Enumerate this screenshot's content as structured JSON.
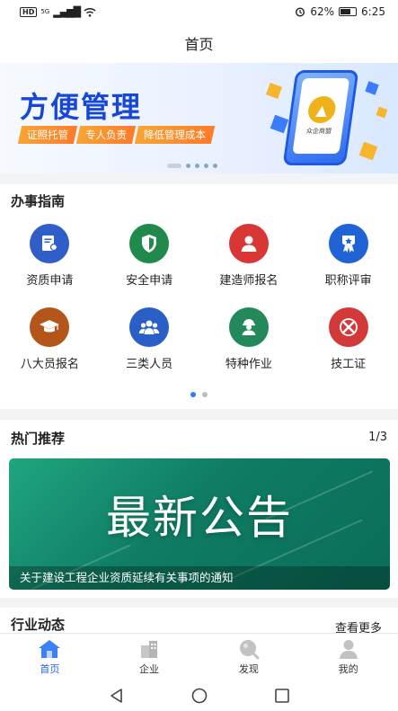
{
  "status": {
    "net": "5G",
    "signal": "..ıl",
    "battery": "62%",
    "time": "6:25"
  },
  "nav": {
    "title": "首页"
  },
  "banner": {
    "title": "方便管理",
    "tags": [
      "证照托管",
      "专人负责",
      "降低管理成本"
    ],
    "phone_text": "众企商盟"
  },
  "guide": {
    "title": "办事指南",
    "items": [
      {
        "label": "资质申请",
        "icon": "certificate-icon",
        "color": "#2f5ec9"
      },
      {
        "label": "安全申请",
        "icon": "shield-icon",
        "color": "#1f8a4c"
      },
      {
        "label": "建造师报名",
        "icon": "person-icon",
        "color": "#d93636"
      },
      {
        "label": "职称评审",
        "icon": "ribbon-icon",
        "color": "#1f63d6"
      },
      {
        "label": "八大员报名",
        "icon": "graduation-cap-icon",
        "color": "#b4561a"
      },
      {
        "label": "三类人员",
        "icon": "group-icon",
        "color": "#2a5fc7"
      },
      {
        "label": "特种作业",
        "icon": "worker-icon",
        "color": "#23885a"
      },
      {
        "label": "技工证",
        "icon": "tools-icon",
        "color": "#d23a3a"
      }
    ]
  },
  "hot": {
    "title": "热门推荐",
    "count": "1/3",
    "headline": "最新公告",
    "caption": "关于建设工程企业资质延续有关事项的通知"
  },
  "news": {
    "title": "行业动态",
    "more": "查看更多"
  },
  "tabs": [
    {
      "label": "首页",
      "icon": "home-icon",
      "active": true
    },
    {
      "label": "企业",
      "icon": "building-icon",
      "active": false
    },
    {
      "label": "发现",
      "icon": "discover-icon",
      "active": false
    },
    {
      "label": "我的",
      "icon": "profile-icon",
      "active": false
    }
  ]
}
